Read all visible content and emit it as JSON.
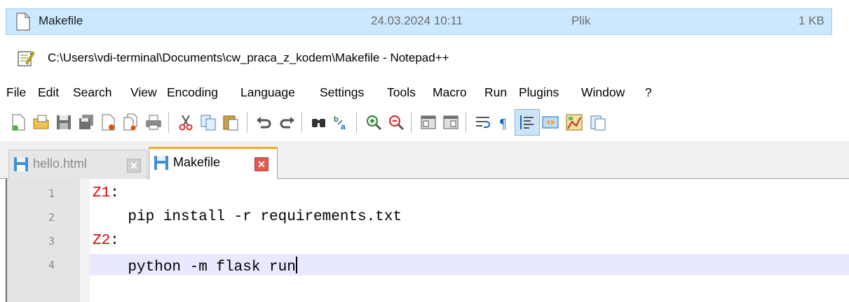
{
  "file_row": {
    "name": "Makefile",
    "modified": "24.03.2024 10:11",
    "type": "Plik",
    "size": "1 KB"
  },
  "window": {
    "title": "C:\\Users\\vdi-terminal\\Documents\\cw_praca_z_kodem\\Makefile - Notepad++"
  },
  "menu": {
    "items": [
      "File",
      "Edit",
      "Search",
      "View",
      "Encoding",
      "Language",
      "Settings",
      "Tools",
      "Macro",
      "Run",
      "Plugins",
      "Window",
      "?"
    ]
  },
  "tabs": [
    {
      "label": "hello.html",
      "active": false
    },
    {
      "label": "Makefile",
      "active": true
    }
  ],
  "editor": {
    "lines": [
      {
        "number": "1",
        "target": "Z1",
        "rest": ":"
      },
      {
        "number": "2",
        "text": "    pip install -r requirements.txt"
      },
      {
        "number": "3",
        "target": "Z2",
        "rest": ":"
      },
      {
        "number": "4",
        "text": "    python -m flask run"
      }
    ],
    "current_line": 4
  },
  "colors": {
    "selection": "#cce8ff",
    "make_target": "#e00000",
    "current_line_bg": "#e8e8ff",
    "active_tab_accent": "#f9a825"
  }
}
